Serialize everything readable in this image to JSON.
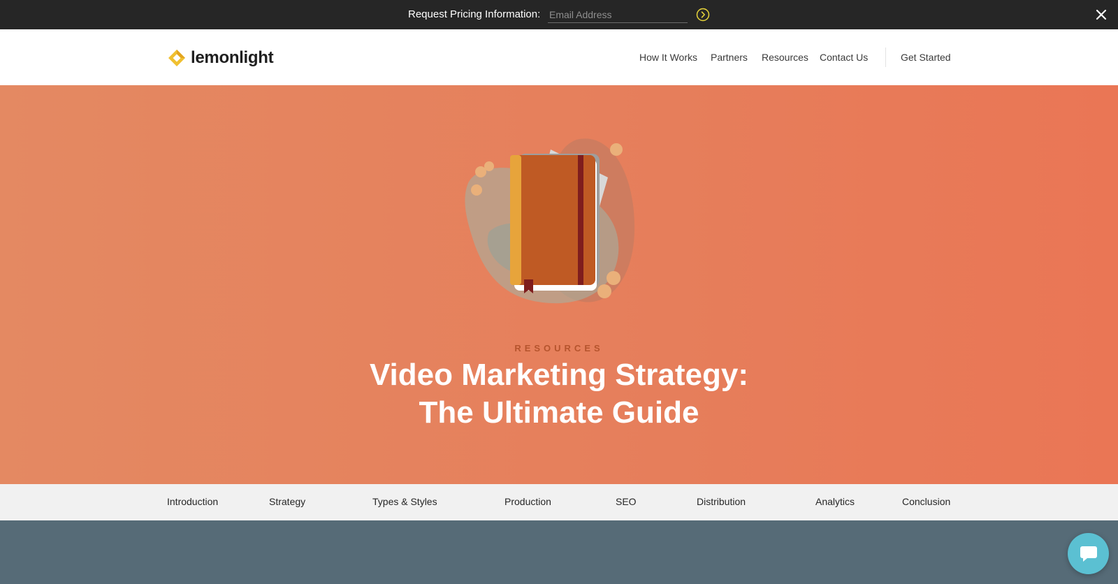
{
  "banner": {
    "label": "Request Pricing Information:",
    "email_placeholder": "Email Address",
    "submit_icon": "arrow-circle-right-icon",
    "close_icon": "close-icon"
  },
  "header": {
    "logo_text": "lemonlight",
    "logo_icon": "lemon-diamond-logo",
    "nav": {
      "how_it_works": "How It Works",
      "partners": "Partners",
      "resources": "Resources",
      "contact_us": "Contact Us",
      "get_started": "Get Started"
    }
  },
  "hero": {
    "eyebrow": "RESOURCES",
    "title_line1": "Video Marketing Strategy:",
    "title_line2": "The Ultimate Guide",
    "illustration": "notebook-icon"
  },
  "section_nav": {
    "introduction": "Introduction",
    "strategy": "Strategy",
    "types_styles": "Types & Styles",
    "production": "Production",
    "seo": "SEO",
    "distribution": "Distribution",
    "analytics": "Analytics",
    "conclusion": "Conclusion"
  },
  "chat": {
    "icon": "chat-bubble-icon"
  },
  "colors": {
    "banner_bg": "#262626",
    "hero_bg": "#e6825d",
    "eyebrow": "#b6542d",
    "section_nav_bg": "#f1f1f1",
    "bottom_band": "#566b77",
    "chat": "#5bc0d2",
    "accent_yellow": "#f0c030"
  }
}
